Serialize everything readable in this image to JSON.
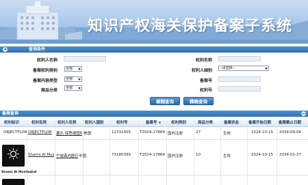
{
  "banner": {
    "title": "知识产权海关保护备案子系统"
  },
  "query": {
    "section_title": "查询条件",
    "fields": {
      "owner_name": {
        "label": "权利人名称",
        "value": ""
      },
      "right_name": {
        "label": "权利名称",
        "value": ""
      },
      "category": {
        "label": "备案权利类别",
        "selected": "全部"
      },
      "owner_country": {
        "label": "权利人国别",
        "selected": "--请选择--"
      },
      "content_type": {
        "label": "备案内容类型",
        "selected": "全部"
      },
      "record_no": {
        "label": "备案号",
        "value": ""
      },
      "goods_class": {
        "label": "商品分类",
        "selected": "全部"
      },
      "right_no": {
        "label": "权利号",
        "value": ""
      }
    },
    "buttons": {
      "fuzzy": "模糊查询",
      "exact": "精确查询"
    }
  },
  "results": {
    "section_title": "备案查询",
    "columns": [
      "权利标识",
      "权利名称",
      "权利人名称",
      "权利人国别",
      "权利号",
      "备案号",
      "权利类别",
      "商品分类",
      "备案状态",
      "备案开始日期",
      "备案截止日期"
    ],
    "rows": [
      {
        "mark": "OBJECTFLOR",
        "right_name": "OBJECTFLOR",
        "owner": "曩氏·保思德国际",
        "country": "美国",
        "right_no": "12331505",
        "record_no": "T2024-17869",
        "right_type": "国内注册",
        "goods_class": "27",
        "status": "生效",
        "start": "2024-10-15",
        "end": "2034-09-06"
      },
      {
        "mark": "Shams Al Mustaqbal",
        "right_name": "Shams Al Mus",
        "owner": "宁波森内医疗器",
        "country": "中国",
        "right_no": "73180399",
        "record_no": "T2024-17869",
        "right_type": "国内注册",
        "goods_class": "10",
        "status": "生效",
        "start": "2024-10-15",
        "end": "2034-01-27"
      }
    ]
  }
}
